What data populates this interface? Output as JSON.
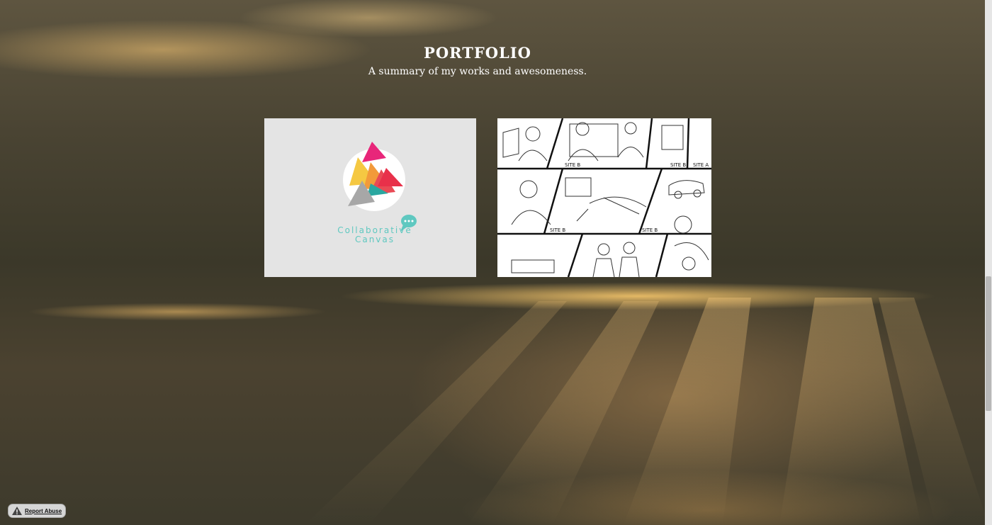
{
  "header": {
    "title": "PORTFOLIO",
    "subtitle": "A summary of my works and awesomeness."
  },
  "portfolio": {
    "items": [
      {
        "caption_line1": "Collaborative",
        "caption_line2": "Canvas",
        "icon": "collaborative-canvas-logo"
      },
      {
        "icon": "storyboard-sketch",
        "panel_labels": [
          "SITE B",
          "SITE B",
          "SITE A",
          "SITE B",
          "SITE B"
        ]
      }
    ]
  },
  "footer": {
    "report_label": "Report Abuse",
    "report_icon": "warning-icon"
  },
  "colors": {
    "accent_teal": "#5fc8c0",
    "tile_bg": "#e4e4e4"
  }
}
